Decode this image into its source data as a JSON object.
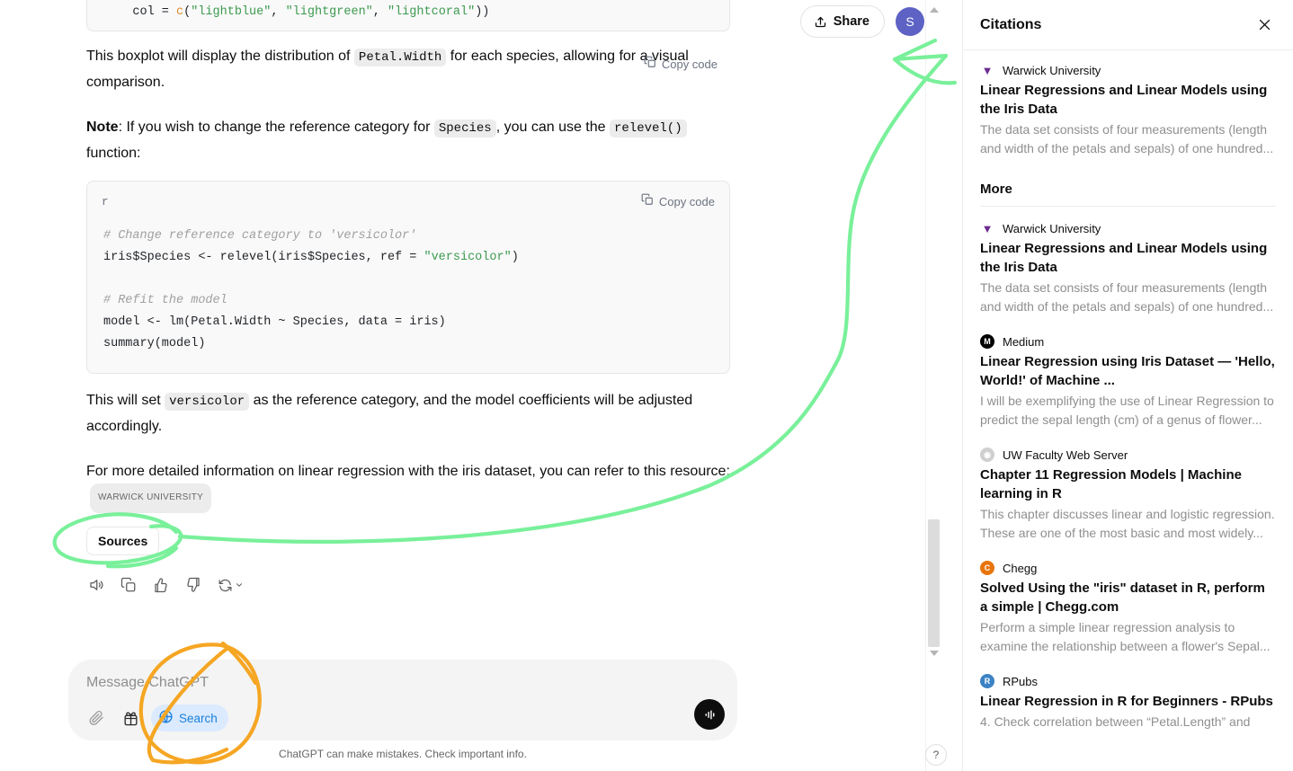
{
  "topbar": {
    "share_label": "Share",
    "avatar_initial": "S"
  },
  "message": {
    "top_code_fragment": "    col = c(\"lightblue\", \"lightgreen\", \"lightcoral\"))",
    "copy_code_label": "Copy code",
    "para1_a": "This boxplot will display the distribution of ",
    "para1_code": "Petal.Width",
    "para1_b": " for each species, allowing for a visual comparison.",
    "para2_strong": "Note",
    "para2_a": ": If you wish to change the reference category for ",
    "para2_code1": "Species",
    "para2_b": ", you can use the ",
    "para2_code2": "relevel()",
    "para2_c": " function:",
    "code_lang": "r",
    "code_line1": "# Change reference category to 'versicolor'",
    "code_line2_a": "iris$Species <- relevel(iris$Species, ref = ",
    "code_line2_str": "\"versicolor\"",
    "code_line2_b": ")",
    "code_line3": "# Refit the model",
    "code_line4": "model <- lm(Petal.Width ~ Species, data = iris)",
    "code_line5": "summary(model)",
    "para3_a": "This will set ",
    "para3_code": "versicolor",
    "para3_b": " as the reference category, and the model coefficients will be adjusted accordingly.",
    "para4": "For more detailed information on linear regression with the iris dataset, you can refer to this resource:",
    "para4_chip": "WARWICK UNIVERSITY",
    "sources_label": "Sources"
  },
  "actions": [
    {
      "name": "read-aloud-icon"
    },
    {
      "name": "copy-icon"
    },
    {
      "name": "thumbs-up-icon"
    },
    {
      "name": "thumbs-down-icon"
    },
    {
      "name": "regenerate-icon"
    }
  ],
  "composer": {
    "placeholder": "Message ChatGPT",
    "search_label": "Search",
    "disclaimer": "ChatGPT can make mistakes. Check important info."
  },
  "help": {
    "label": "?"
  },
  "citations": {
    "title": "Citations",
    "more_label": "More",
    "primary": {
      "source": "Warwick University",
      "favicon": "warwick-icon",
      "title": "Linear Regressions and Linear Models using the Iris Data",
      "desc": "The data set consists of four measurements (length and width of the petals and sepals) of one hundred..."
    },
    "items": [
      {
        "source": "Warwick University",
        "favicon": "warwick-icon",
        "favicon_class": "warwick",
        "favicon_glyph": "▼",
        "title": "Linear Regressions and Linear Models using the Iris Data",
        "desc": "The data set consists of four measurements (length and width of the petals and sepals) of one hundred..."
      },
      {
        "source": "Medium",
        "favicon": "medium-icon",
        "favicon_class": "medium",
        "favicon_glyph": "M",
        "title": "Linear Regression using Iris Dataset — 'Hello, World!' of Machine ...",
        "desc": "I will be exemplifying the use of Linear Regression to predict the sepal length (cm) of a genus of flower..."
      },
      {
        "source": "UW Faculty Web Server",
        "favicon": "uw-icon",
        "favicon_class": "uw",
        "favicon_glyph": "⊘",
        "title": "Chapter 11 Regression Models | Machine learning in R",
        "desc": "This chapter discusses linear and logistic regression. These are one of the most basic and most widely..."
      },
      {
        "source": "Chegg",
        "favicon": "chegg-icon",
        "favicon_class": "chegg",
        "favicon_glyph": "C",
        "title": "Solved Using the \"iris\" dataset in R, perform a simple | Chegg.com",
        "desc": "Perform a simple linear regression analysis to examine the relationship between a flower's Sepal..."
      },
      {
        "source": "RPubs",
        "favicon": "rpubs-icon",
        "favicon_class": "rpubs",
        "favicon_glyph": "R",
        "title": "Linear Regression in R for Beginners - RPubs",
        "desc": "4. Check correlation between “Petal.Length” and"
      }
    ]
  },
  "annotations": {
    "green_color": "#79f09a",
    "orange_color": "#f5a623"
  }
}
